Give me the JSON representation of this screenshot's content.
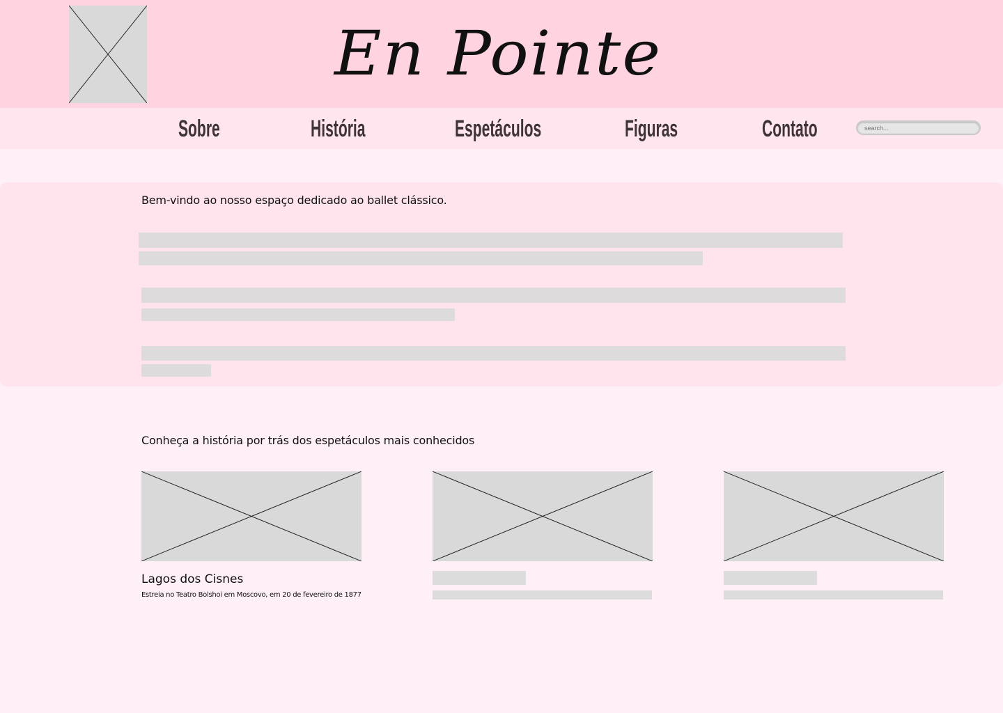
{
  "header": {
    "site_title": "En Pointe"
  },
  "nav": {
    "items": [
      {
        "label": "Sobre"
      },
      {
        "label": "História"
      },
      {
        "label": "Espetáculos"
      },
      {
        "label": "Figuras"
      },
      {
        "label": "Contato"
      }
    ]
  },
  "search": {
    "placeholder": "search..."
  },
  "intro": {
    "heading": "Bem-vindo ao nosso espaço dedicado ao ballet clássico."
  },
  "shows": {
    "heading": "Conheça a história por trás dos espetáculos mais conhecidos",
    "cards": [
      {
        "title": "Lagos dos Cisnes",
        "subtitle": "Estreia no Teatro Bolshoi em Moscovo, em 20 de fevereiro de 1877"
      }
    ]
  }
}
